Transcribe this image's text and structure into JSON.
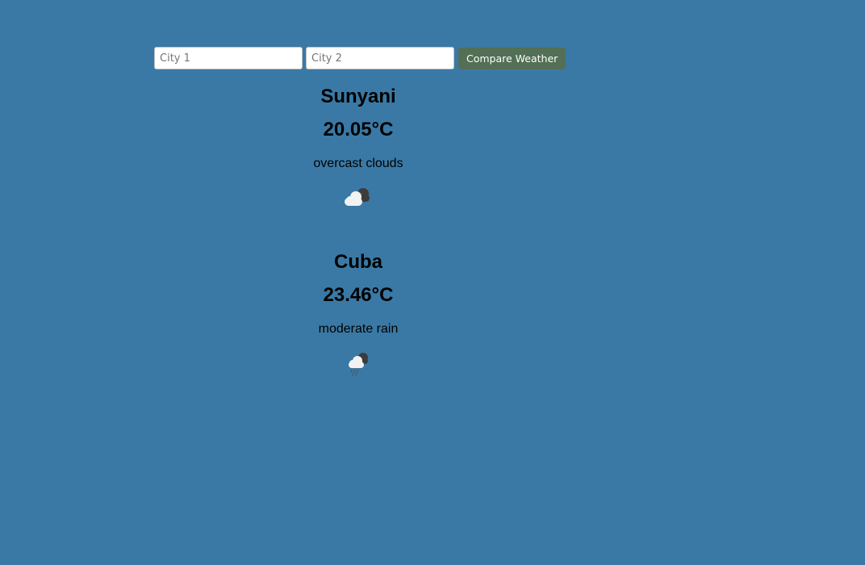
{
  "search": {
    "city1_placeholder": "City 1",
    "city2_placeholder": "City 2",
    "city1_value": "",
    "city2_value": "",
    "compare_label": "Compare Weather"
  },
  "results": [
    {
      "city": "Sunyani",
      "temperature": "20.05°C",
      "description": "overcast clouds",
      "icon": "overcast-clouds-icon"
    },
    {
      "city": "Cuba",
      "temperature": "23.46°C",
      "description": "moderate rain",
      "icon": "rain-cloud-icon"
    }
  ],
  "colors": {
    "background": "#3a79a5",
    "button": "#536f55",
    "button_text": "#ffffff"
  }
}
